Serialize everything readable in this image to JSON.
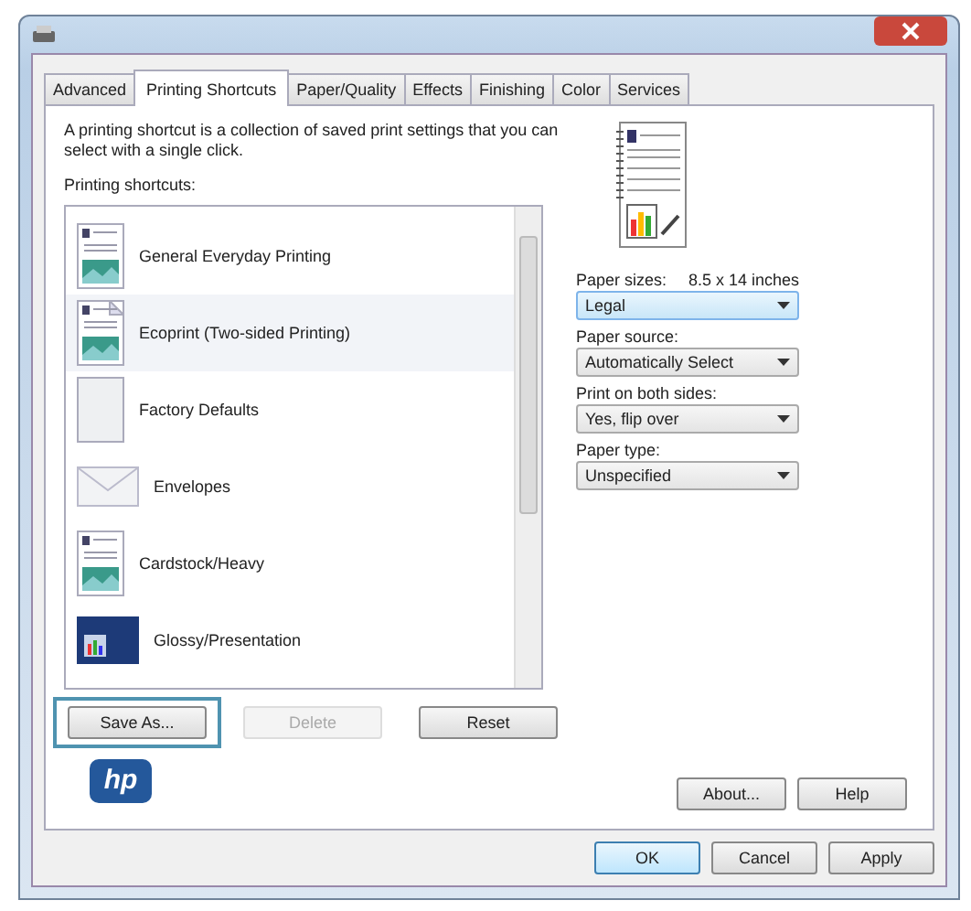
{
  "tabs": [
    {
      "label": "Advanced",
      "selected": false
    },
    {
      "label": "Printing Shortcuts",
      "selected": true
    },
    {
      "label": "Paper/Quality",
      "selected": false
    },
    {
      "label": "Effects",
      "selected": false
    },
    {
      "label": "Finishing",
      "selected": false
    },
    {
      "label": "Color",
      "selected": false
    },
    {
      "label": "Services",
      "selected": false
    }
  ],
  "description": "A printing shortcut is a collection of saved print settings that you can select with a single click.",
  "shortcuts_label": "Printing shortcuts:",
  "shortcuts": [
    {
      "label": "General Everyday Printing",
      "kind": "document",
      "selected": false
    },
    {
      "label": "Ecoprint (Two-sided Printing)",
      "kind": "duplex",
      "selected": true
    },
    {
      "label": "Factory Defaults",
      "kind": "blank",
      "selected": false
    },
    {
      "label": "Envelopes",
      "kind": "envelope",
      "selected": false
    },
    {
      "label": "Cardstock/Heavy",
      "kind": "card",
      "selected": false
    },
    {
      "label": "Glossy/Presentation",
      "kind": "presentation",
      "selected": false
    }
  ],
  "list_buttons": [
    {
      "label": "Save As...",
      "disabled": false,
      "highlighted": true
    },
    {
      "label": "Delete",
      "disabled": true,
      "highlighted": false
    },
    {
      "label": "Reset",
      "disabled": false,
      "highlighted": false
    }
  ],
  "paper_size_reading": "8.5 x 14 inches",
  "settings": [
    {
      "label": "Paper sizes:",
      "value": "Legal",
      "focused": true
    },
    {
      "label": "Paper source:",
      "value": "Automatically Select",
      "focused": false
    },
    {
      "label": "Print on both sides:",
      "value": "Yes, flip over",
      "focused": false
    },
    {
      "label": "Paper type:",
      "value": "Unspecified",
      "focused": false
    }
  ],
  "logo_text": "hp",
  "help_buttons": [
    "About...",
    "Help"
  ],
  "dialog_buttons": [
    {
      "label": "OK",
      "default": true
    },
    {
      "label": "Cancel",
      "default": false
    },
    {
      "label": "Apply",
      "default": false
    }
  ]
}
